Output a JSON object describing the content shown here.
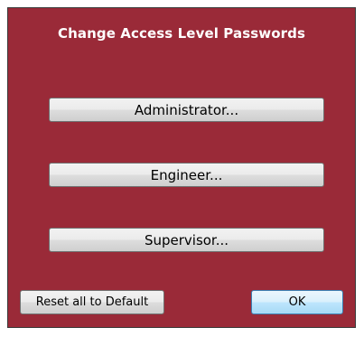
{
  "dialog": {
    "title": "Change Access Level Passwords",
    "background_color": "#9a2a38"
  },
  "buttons": {
    "administrator": "Administrator...",
    "engineer": "Engineer...",
    "supervisor": "Supervisor...",
    "reset_default": "Reset all to Default",
    "ok": "OK"
  }
}
